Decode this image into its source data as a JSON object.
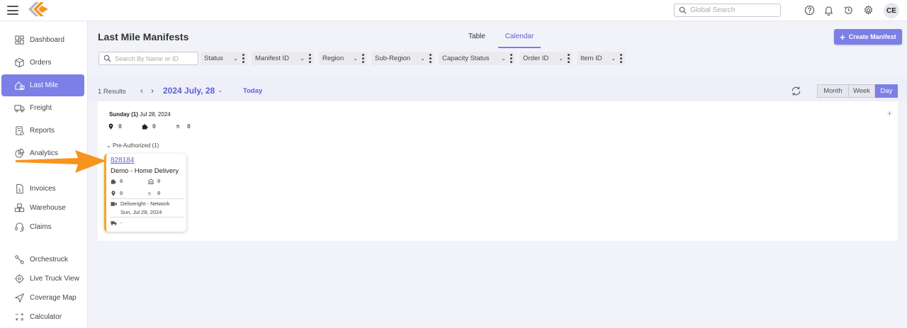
{
  "header": {
    "search_placeholder": "Global Search",
    "avatar_initials": "CE",
    "icons": [
      "help-icon",
      "bell-icon",
      "history-icon",
      "gear-icon"
    ]
  },
  "sidebar": {
    "items": [
      {
        "label": "Dashboard",
        "icon": "dashboard-icon",
        "active": false
      },
      {
        "label": "Orders",
        "icon": "box-icon",
        "active": false
      },
      {
        "label": "Last Mile",
        "icon": "house-truck-icon",
        "active": true
      },
      {
        "label": "Freight",
        "icon": "freight-truck-icon",
        "active": false
      },
      {
        "label": "Reports",
        "icon": "report-icon",
        "active": false
      },
      {
        "label": "Analytics",
        "icon": "pie-chart-icon",
        "active": false
      },
      {
        "label": "Invoices",
        "icon": "invoice-icon",
        "active": false
      },
      {
        "label": "Warehouse",
        "icon": "boxes-icon",
        "active": false
      },
      {
        "label": "Claims",
        "icon": "headset-icon",
        "active": false
      },
      {
        "label": "Orchestruck",
        "icon": "route-icon",
        "active": false
      },
      {
        "label": "Live Truck View",
        "icon": "target-icon",
        "active": false
      },
      {
        "label": "Coverage Map",
        "icon": "navigation-icon",
        "active": false
      },
      {
        "label": "Calculator",
        "icon": "calculator-icon",
        "active": false
      }
    ]
  },
  "main": {
    "title": "Last Mile Manifests",
    "tabs": [
      {
        "label": "Table",
        "active": false
      },
      {
        "label": "Calendar",
        "active": true
      }
    ],
    "create_button": "Create Manifest",
    "search_placeholder": "Search By Name or ID",
    "filters": [
      "Status",
      "Manifest ID",
      "Region",
      "Sub-Region",
      "Capacity Status",
      "Order ID",
      "Item ID"
    ]
  },
  "calendar": {
    "results": "1 Results",
    "date": "2024 July, 28",
    "today_label": "Today",
    "views": [
      {
        "label": "Month",
        "active": false
      },
      {
        "label": "Week",
        "active": false
      },
      {
        "label": "Day",
        "active": true
      }
    ],
    "day_header_bold": "Sunday (1)",
    "day_header_date": "Jul 28, 2024",
    "stats": {
      "locations": "0",
      "pieces": "0",
      "weight": "0"
    },
    "group_label": "Pre-Authorized (1)",
    "card": {
      "manifest_id": "828184",
      "name": "Demo - Home Delivery",
      "pieces": "0",
      "capacity": "0",
      "stops": "0",
      "weight": "0",
      "network": "Deliveright - Network",
      "date": "Sun, Jul 28, 2024",
      "truck": "-",
      "accent_color": "#f5a623"
    }
  },
  "colors": {
    "accent": "#7b7fe6",
    "annotation": "#f7941d"
  }
}
